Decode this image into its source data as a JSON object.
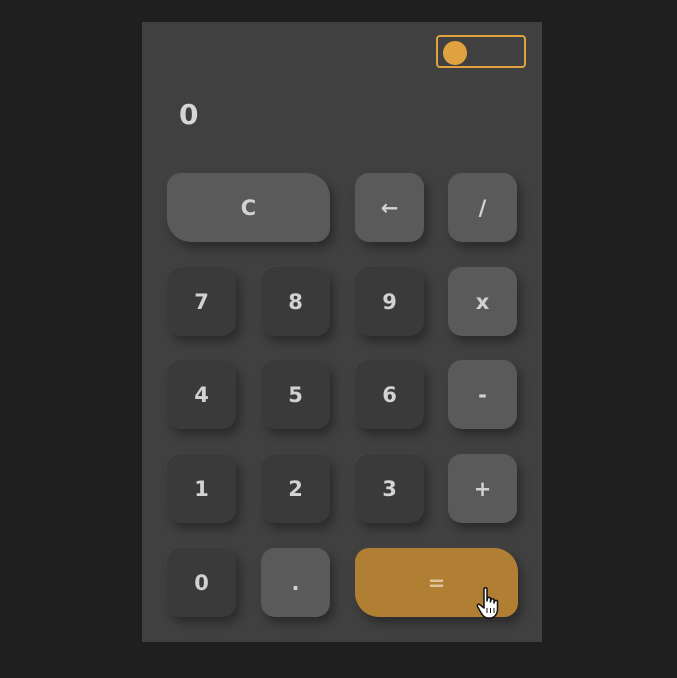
{
  "display": {
    "value": "0"
  },
  "toggle": {
    "state": "off",
    "accent_color": "#e0a23f"
  },
  "buttons": {
    "clear": "C",
    "backspace": "←",
    "divide": "/",
    "seven": "7",
    "eight": "8",
    "nine": "9",
    "multiply": "x",
    "four": "4",
    "five": "5",
    "six": "6",
    "subtract": "-",
    "one": "1",
    "two": "2",
    "three": "3",
    "add": "+",
    "zero": "0",
    "decimal": ".",
    "equals": "="
  },
  "colors": {
    "page_bg": "#1f1f1f",
    "calculator_bg": "#404040",
    "digit_button": "#3a3a3a",
    "operator_button": "#5a5a5a",
    "equals_button": "#b07f33"
  },
  "cursor_icon": "hand-pointer-icon"
}
